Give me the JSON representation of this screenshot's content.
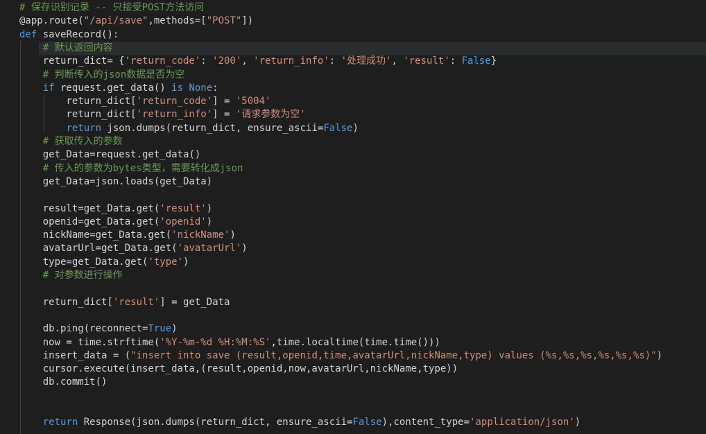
{
  "colors": {
    "background": "#1e1e1e",
    "keyword": "#569cd6",
    "function": "#dcdcaa",
    "string": "#ce9178",
    "comment": "#6a9955",
    "plain": "#d4d4d4",
    "variable": "#9cdcfe",
    "indent_guide": "#404040",
    "current_line": "#2a2d2e"
  },
  "lines": [
    [
      [
        "cmt",
        "# 保存识别记录 -- 只接受POST方法访问"
      ]
    ],
    [
      [
        "pl",
        "@app.route("
      ],
      [
        "str",
        "\"/api/save\""
      ],
      [
        "pl",
        ",methods=["
      ],
      [
        "str",
        "\"POST\""
      ],
      [
        "pl",
        "])"
      ]
    ],
    [
      [
        "kw",
        "def"
      ],
      [
        "pl",
        " saveRecord():"
      ]
    ],
    [
      [
        "pl",
        "    "
      ],
      [
        "cmt",
        "# 默认返回内容"
      ]
    ],
    [
      [
        "pl",
        "    return_dict= {"
      ],
      [
        "str",
        "'return_code'"
      ],
      [
        "pl",
        ": "
      ],
      [
        "str",
        "'200'"
      ],
      [
        "pl",
        ", "
      ],
      [
        "str",
        "'return_info'"
      ],
      [
        "pl",
        ": "
      ],
      [
        "str",
        "'处理成功'"
      ],
      [
        "pl",
        ", "
      ],
      [
        "str",
        "'result'"
      ],
      [
        "pl",
        ": "
      ],
      [
        "kw",
        "False"
      ],
      [
        "pl",
        "}"
      ]
    ],
    [
      [
        "pl",
        "    "
      ],
      [
        "cmt",
        "# 判断传入的json数据是否为空"
      ]
    ],
    [
      [
        "pl",
        "    "
      ],
      [
        "kw",
        "if"
      ],
      [
        "pl",
        " request.get_data() "
      ],
      [
        "kw",
        "is"
      ],
      [
        "pl",
        " "
      ],
      [
        "kw",
        "None"
      ],
      [
        "pl",
        ":"
      ]
    ],
    [
      [
        "pl",
        "        return_dict["
      ],
      [
        "str",
        "'return_code'"
      ],
      [
        "pl",
        "] = "
      ],
      [
        "str",
        "'5004'"
      ]
    ],
    [
      [
        "pl",
        "        return_dict["
      ],
      [
        "str",
        "'return_info'"
      ],
      [
        "pl",
        "] = "
      ],
      [
        "str",
        "'请求参数为空'"
      ]
    ],
    [
      [
        "pl",
        "        "
      ],
      [
        "kw",
        "return"
      ],
      [
        "pl",
        " json.dumps(return_dict, ensure_ascii="
      ],
      [
        "kw",
        "False"
      ],
      [
        "pl",
        ")"
      ]
    ],
    [
      [
        "pl",
        "    "
      ],
      [
        "cmt",
        "# 获取传入的参数"
      ]
    ],
    [
      [
        "pl",
        "    get_Data=request.get_data()"
      ]
    ],
    [
      [
        "pl",
        "    "
      ],
      [
        "cmt",
        "# 传入的参数为bytes类型，需要转化成json"
      ]
    ],
    [
      [
        "pl",
        "    get_Data=json.loads(get_Data)"
      ]
    ],
    [
      [
        "pl",
        ""
      ]
    ],
    [
      [
        "pl",
        "    result=get_Data.get("
      ],
      [
        "str",
        "'result'"
      ],
      [
        "pl",
        ")"
      ]
    ],
    [
      [
        "pl",
        "    openid=get_Data.get("
      ],
      [
        "str",
        "'openid'"
      ],
      [
        "pl",
        ")"
      ]
    ],
    [
      [
        "pl",
        "    nickName=get_Data.get("
      ],
      [
        "str",
        "'nickName'"
      ],
      [
        "pl",
        ")"
      ]
    ],
    [
      [
        "pl",
        "    avatarUrl=get_Data.get("
      ],
      [
        "str",
        "'avatarUrl'"
      ],
      [
        "pl",
        ")"
      ]
    ],
    [
      [
        "pl",
        "    type=get_Data.get("
      ],
      [
        "str",
        "'type'"
      ],
      [
        "pl",
        ")"
      ]
    ],
    [
      [
        "pl",
        "    "
      ],
      [
        "cmt",
        "# 对参数进行操作"
      ]
    ],
    [
      [
        "pl",
        ""
      ]
    ],
    [
      [
        "pl",
        "    return_dict["
      ],
      [
        "str",
        "'result'"
      ],
      [
        "pl",
        "] = get_Data"
      ]
    ],
    [
      [
        "pl",
        ""
      ]
    ],
    [
      [
        "pl",
        "    db.ping(reconnect="
      ],
      [
        "kw",
        "True"
      ],
      [
        "pl",
        ")"
      ]
    ],
    [
      [
        "pl",
        "    now = time.strftime("
      ],
      [
        "str",
        "'%Y-%m-%d %H:%M:%S'"
      ],
      [
        "pl",
        ",time.localtime(time.time()))"
      ]
    ],
    [
      [
        "pl",
        "    insert_data = ("
      ],
      [
        "str",
        "\"insert into save (result,openid,time,avatarUrl,nickName,type) values (%s,%s,%s,%s,%s,%s)\""
      ],
      [
        "pl",
        ")"
      ]
    ],
    [
      [
        "pl",
        "    cursor.execute(insert_data,(result,openid,now,avatarUrl,nickName,type))"
      ]
    ],
    [
      [
        "pl",
        "    db.commit()"
      ]
    ],
    [
      [
        "pl",
        ""
      ]
    ],
    [
      [
        "pl",
        ""
      ]
    ],
    [
      [
        "pl",
        "    "
      ],
      [
        "kw",
        "return"
      ],
      [
        "pl",
        " Response(json.dumps(return_dict, ensure_ascii="
      ],
      [
        "kw",
        "False"
      ],
      [
        "pl",
        "),content_type="
      ],
      [
        "str",
        "'application/json'"
      ],
      [
        "pl",
        ")"
      ]
    ]
  ]
}
